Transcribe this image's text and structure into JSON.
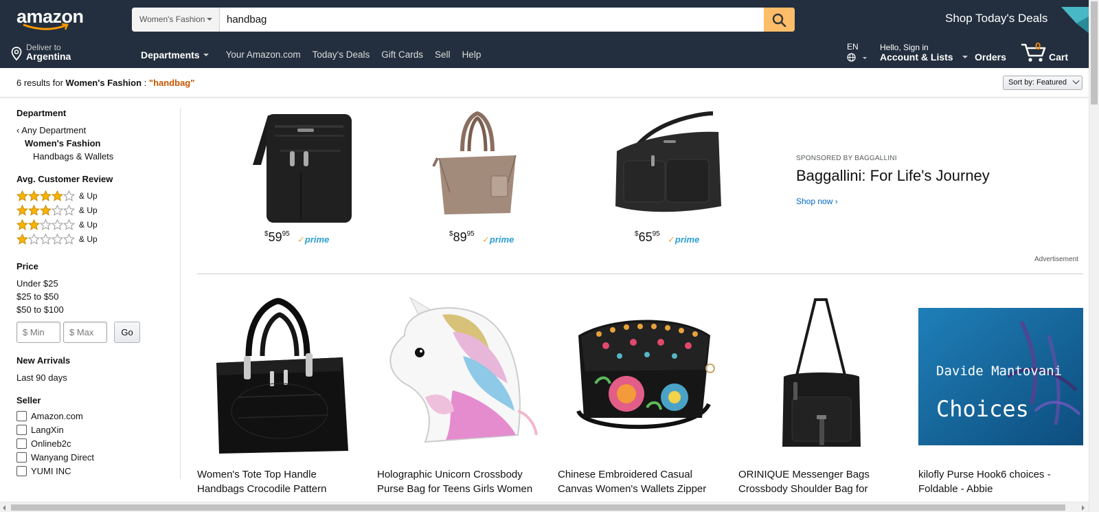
{
  "header": {
    "logo_text": "amazon",
    "search": {
      "department": "Women's Fashion",
      "query": "handbag"
    },
    "deals_banner": "Shop Today's Deals",
    "deliver": {
      "line1": "Deliver to",
      "line2": "Argentina"
    },
    "departments_label": "Departments",
    "nav_links": [
      "Your Amazon.com",
      "Today's Deals",
      "Gift Cards",
      "Sell",
      "Help"
    ],
    "language": "EN",
    "account": {
      "line1": "Hello, Sign in",
      "line2": "Account & Lists"
    },
    "orders": "Orders",
    "cart": {
      "count": "0",
      "label": "Cart"
    }
  },
  "results": {
    "count_text": "6 results for",
    "category": "Women's Fashion",
    "separator": ":",
    "query": "\"handbag\"",
    "sort_label": "Sort by:",
    "sort_value": "Featured"
  },
  "sidebar": {
    "department_heading": "Department",
    "any_department": "Any Department",
    "department_selected": "Women's Fashion",
    "department_sub": "Handbags & Wallets",
    "review_heading": "Avg. Customer Review",
    "review_rows": [
      {
        "stars": 4,
        "label": "& Up"
      },
      {
        "stars": 3,
        "label": "& Up"
      },
      {
        "stars": 2,
        "label": "& Up"
      },
      {
        "stars": 1,
        "label": "& Up"
      }
    ],
    "price_heading": "Price",
    "price_ranges": [
      "Under $25",
      "$25 to $50",
      "$50 to $100"
    ],
    "price_min_placeholder": "$ Min",
    "price_max_placeholder": "$ Max",
    "go_label": "Go",
    "arrivals_heading": "New Arrivals",
    "arrivals_option": "Last 90 days",
    "seller_heading": "Seller",
    "sellers": [
      "Amazon.com",
      "LangXin",
      "Onlineb2c",
      "Wanyang Direct",
      "YUMI INC"
    ]
  },
  "sponsored": {
    "items": [
      {
        "dollars": "59",
        "cents": "95",
        "prime": "prime"
      },
      {
        "dollars": "89",
        "cents": "95",
        "prime": "prime"
      },
      {
        "dollars": "65",
        "cents": "95",
        "prime": "prime"
      }
    ],
    "label": "SPONSORED BY BAGGALLINI",
    "title": "Baggallini: For Life's Journey",
    "link": "Shop now",
    "ad_label": "Advertisement"
  },
  "products": [
    {
      "title_l1": "Women's Tote Top Handle",
      "title_l2": "Handbags Crocodile Pattern"
    },
    {
      "title_l1": "Holographic Unicorn Crossbody",
      "title_l2": "Purse Bag for Teens Girls Women"
    },
    {
      "title_l1": "Chinese Embroidered Casual",
      "title_l2": "Canvas Women's Wallets Zipper"
    },
    {
      "title_l1": "ORINIQUE Messenger Bags",
      "title_l2": "Crossbody Shoulder Bag for"
    },
    {
      "title_l1": "kilofly Purse Hook6 choices -",
      "title_l2": "Foldable - Abbie",
      "image_text_1": "Davide Mantovani",
      "image_text_2": "Choices"
    }
  ],
  "colors": {
    "header_bg": "#232f3e",
    "search_button": "#febd69",
    "cart_count": "#f08804",
    "query_highlight": "#c45500",
    "link": "#0066c0",
    "prime_blue": "#2b9ed2",
    "star": "#f8b400"
  }
}
